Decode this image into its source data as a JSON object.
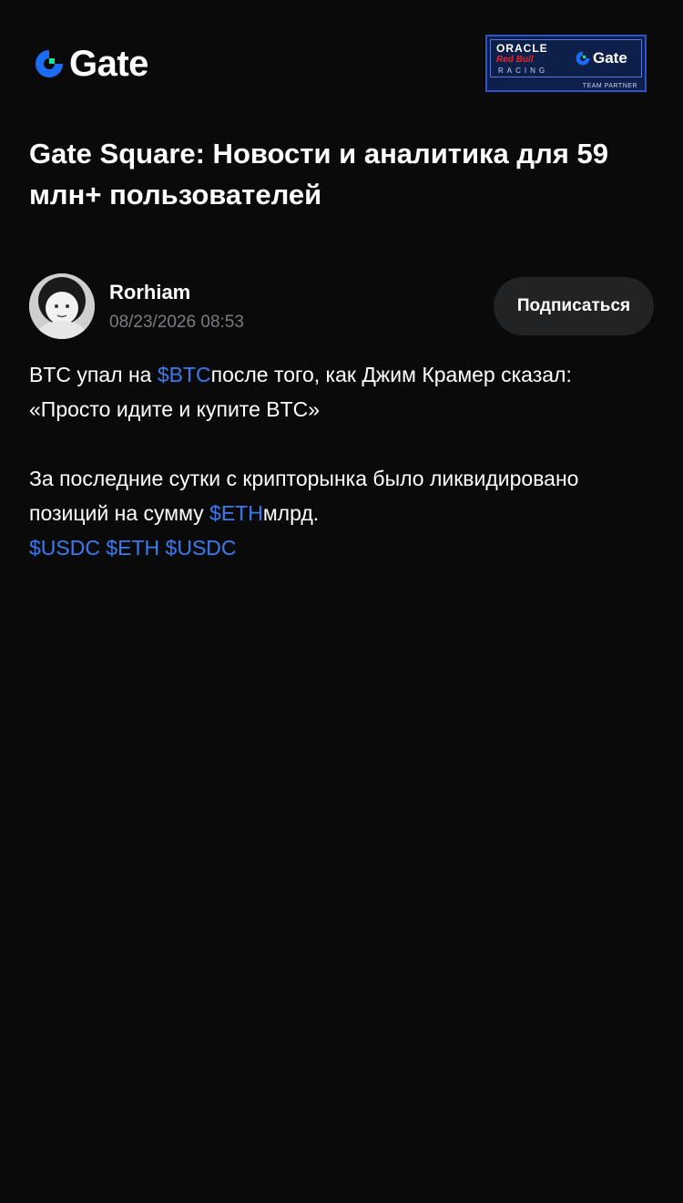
{
  "header": {
    "logo_text": "Gate",
    "partner_badge": {
      "oracle": "ORACLE",
      "redbull": "Red Bull",
      "racing": "RACING",
      "gate": "Gate",
      "team_partner": "TEAM PARTNER"
    }
  },
  "page_title": "Gate Square: Новости и аналитика для 59 млн+ пользователей",
  "author": {
    "name": "Rorhiam",
    "timestamp": "08/23/2026 08:53",
    "follow_label": "Подписаться"
  },
  "post": {
    "p1_before": "BTC упал на ",
    "p1_tag": "$BTC",
    "p1_after": "после того, как Джим Крамер сказал: «Просто идите и купите BTC»",
    "p2_before": "За последние сутки с крипторынка было ликвидировано позиций на сумму ",
    "p2_tag": "$ETH",
    "p2_after": "млрд.",
    "tags": [
      "$USDC",
      "$ETH",
      "$USDC"
    ]
  },
  "colors": {
    "background": "#0a0a0b",
    "accent_link": "#3b7bf0",
    "gate_blue": "#1c6bf5",
    "gate_green": "#17e2a0",
    "button_bg": "#222325",
    "muted_text": "#7c7c80"
  }
}
